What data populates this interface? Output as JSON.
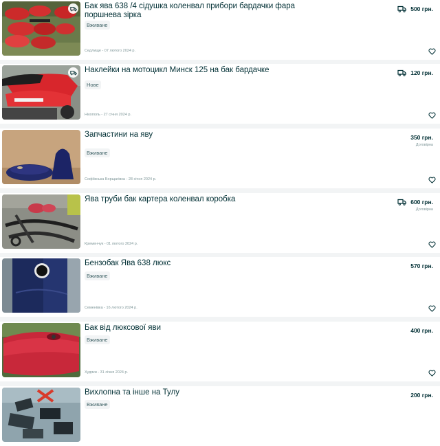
{
  "listings": [
    {
      "title": "Бак ява 638 /4 сідушка коленвал прибори бардачки фара поршнева зірка",
      "condition": "Вживане",
      "location_date": "Седлище - 07 лютого 2024 р.",
      "price": "500 грн.",
      "negotiable": "",
      "delivery": true
    },
    {
      "title": "Наклейки на мотоцикл Минск 125 на бак бардачке",
      "condition": "Нове",
      "location_date": "Нікополь - 27 січня 2024 р.",
      "price": "120 грн.",
      "negotiable": "",
      "delivery": true
    },
    {
      "title": "Запчастини на яву",
      "condition": "Вживане",
      "location_date": "Софіївська Борщагівка - 28 січня 2024 р.",
      "price": "350 грн.",
      "negotiable": "Договірна",
      "delivery": false
    },
    {
      "title": "Ява труби бак картера коленвал коробка",
      "condition": "",
      "location_date": "Кременчук - 01 лютого 2024 р.",
      "price": "600 грн.",
      "negotiable": "Договірна",
      "delivery": true
    },
    {
      "title": "Бензобак Ява 638 люкс",
      "condition": "Вживане",
      "location_date": "Семенівка - 16 лютого 2024 р.",
      "price": "570 грн.",
      "negotiable": "",
      "delivery": false
    },
    {
      "title": "Бак від люксової яви",
      "condition": "Вживане",
      "location_date": "Худяки - 31 січня 2024 р.",
      "price": "400 грн.",
      "negotiable": "",
      "delivery": false
    },
    {
      "title": "Вихлопна та інше на Тулу",
      "condition": "Вживане",
      "location_date": "",
      "price": "200 грн.",
      "negotiable": "",
      "delivery": false
    }
  ],
  "icons": {
    "delivery": "truck-icon",
    "favorite": "heart-outline-icon",
    "photo_delivery_badge": "delivery-badge-icon"
  },
  "colors": {
    "text": "#002f34",
    "muted": "#7f9799",
    "background": "#f2f4f5",
    "tag_bg": "#f2f4f5"
  }
}
